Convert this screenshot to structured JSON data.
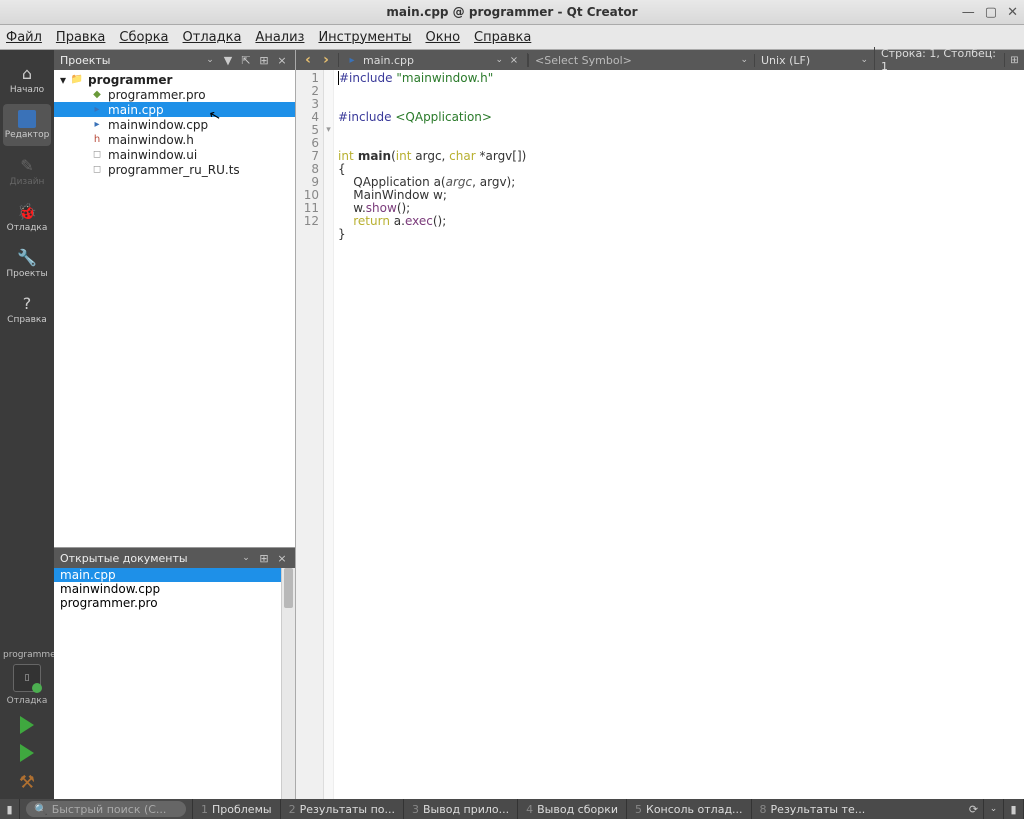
{
  "titlebar": {
    "title": "main.cpp @ programmer - Qt Creator"
  },
  "menu": {
    "file": "Файл",
    "edit": "Правка",
    "build": "Сборка",
    "debug": "Отладка",
    "analyze": "Анализ",
    "tools": "Инструменты",
    "window": "Окно",
    "help": "Справка"
  },
  "modebar": {
    "welcome": "Начало",
    "edit": "Редактор",
    "design": "Дизайн",
    "debug": "Отладка",
    "projects": "Проекты",
    "help": "Справка",
    "kit_name": "programmer",
    "kit_mode": "Отладка"
  },
  "side": {
    "projects_title": "Проекты",
    "tree": {
      "root": "programmer",
      "items": [
        {
          "name": "programmer.pro",
          "icon": "file-pro"
        },
        {
          "name": "main.cpp",
          "icon": "file-cpp",
          "selected": true
        },
        {
          "name": "mainwindow.cpp",
          "icon": "file-cpp"
        },
        {
          "name": "mainwindow.h",
          "icon": "file-h"
        },
        {
          "name": "mainwindow.ui",
          "icon": "file-ui"
        },
        {
          "name": "programmer_ru_RU.ts",
          "icon": "file-ts"
        }
      ]
    },
    "open_docs_title": "Открытые документы",
    "open_docs": [
      {
        "name": "main.cpp",
        "selected": true
      },
      {
        "name": "mainwindow.cpp"
      },
      {
        "name": "programmer.pro"
      }
    ]
  },
  "editor": {
    "file_name": "main.cpp",
    "select_symbol": "<Select Symbol>",
    "encoding": "Unix (LF)",
    "position": "Строка: 1, Столбец: 1",
    "lines": [
      "1",
      "2",
      "3",
      "4",
      "5",
      "6",
      "7",
      "8",
      "9",
      "10",
      "11",
      "12"
    ],
    "code": {
      "l1a": "#include ",
      "l1b": "\"mainwindow.h\"",
      "l3a": "#include ",
      "l3b": "<QApplication>",
      "l5a": "int",
      "l5b": " main",
      "l5c": "(",
      "l5d": "int",
      "l5e": " argc, ",
      "l5f": "char",
      "l5g": " *argv[])",
      "l6": "{",
      "l7a": "    QApplication a(",
      "l7b": "argc",
      "l7c": ", argv);",
      "l8a": "    MainWindow w;",
      "l9a": "    w.",
      "l9b": "show",
      "l9c": "();",
      "l10a": "    return",
      "l10b": " a.",
      "l10c": "exec",
      "l10d": "();",
      "l11": "}"
    }
  },
  "statusbar": {
    "search_placeholder": "Быстрый поиск (C...",
    "items": [
      {
        "n": "1",
        "label": "Проблемы"
      },
      {
        "n": "2",
        "label": "Результаты по..."
      },
      {
        "n": "3",
        "label": "Вывод прило..."
      },
      {
        "n": "4",
        "label": "Вывод сборки"
      },
      {
        "n": "5",
        "label": "Консоль отлад..."
      },
      {
        "n": "8",
        "label": "Результаты те..."
      }
    ]
  }
}
